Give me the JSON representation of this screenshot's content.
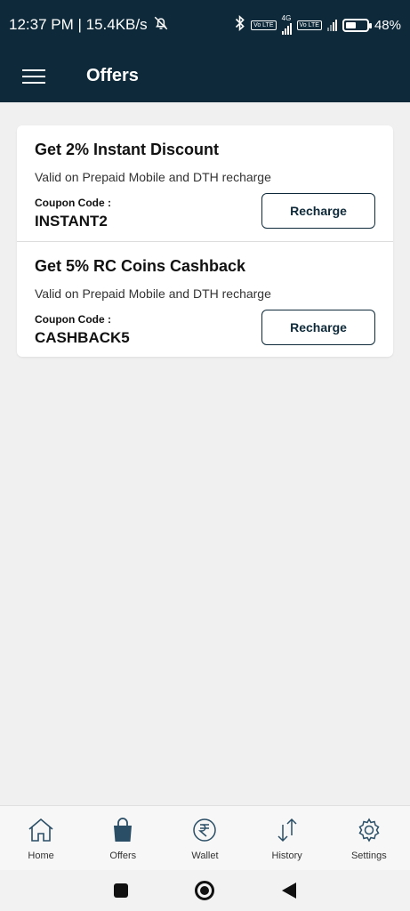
{
  "status_bar": {
    "time_speed": "12:37 PM | 15.4KB/s",
    "network_type": "4G",
    "volte_label": "Vo LTE",
    "battery_percent": "48%",
    "battery_level": 0.48,
    "icons": [
      "alarm-off-icon",
      "bluetooth-icon",
      "signal-icon",
      "battery-icon"
    ]
  },
  "app_bar": {
    "title": "Offers",
    "menu_icon": "hamburger-menu-icon"
  },
  "offers": [
    {
      "title": "Get 2% Instant Discount",
      "description": "Valid on Prepaid Mobile and DTH recharge",
      "coupon_label": "Coupon Code :",
      "coupon_code": "INSTANT2",
      "button_label": "Recharge"
    },
    {
      "title": "Get 5% RC Coins Cashback",
      "description": "Valid on Prepaid Mobile and DTH recharge",
      "coupon_label": "Coupon Code :",
      "coupon_code": "CASHBACK5",
      "button_label": "Recharge"
    }
  ],
  "bottom_nav": {
    "items": [
      {
        "label": "Home",
        "icon": "home-icon"
      },
      {
        "label": "Offers",
        "icon": "shopping-bag-icon",
        "active": true
      },
      {
        "label": "Wallet",
        "icon": "rupee-icon"
      },
      {
        "label": "History",
        "icon": "arrows-up-down-icon"
      },
      {
        "label": "Settings",
        "icon": "gear-icon"
      }
    ]
  },
  "colors": {
    "primary": "#0e2a3a",
    "background": "#f0f0f0",
    "card": "#ffffff"
  }
}
